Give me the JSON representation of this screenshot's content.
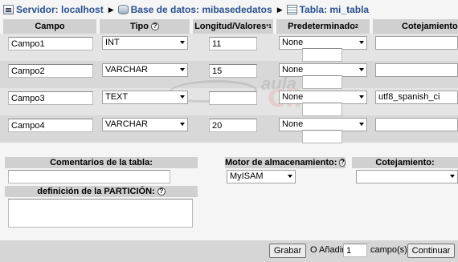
{
  "breadcrumb": {
    "server_label": "Servidor: localhost",
    "database_label": "Base de datos: mibasededatos",
    "table_label": "Tabla: mi_tabla"
  },
  "columns": {
    "campo": "Campo",
    "tipo": "Tipo",
    "longitud": "Longitud/Valores",
    "longitud_sup": "*1",
    "predeterminado": "Predeterminado",
    "predeterminado_sup": "2",
    "cotejamiento": "Cotejamiento"
  },
  "rows": [
    {
      "name": "Campo1",
      "type": "INT",
      "length": "11",
      "default": "None",
      "collation": ""
    },
    {
      "name": "Campo2",
      "type": "VARCHAR",
      "length": "15",
      "default": "None",
      "collation": ""
    },
    {
      "name": "Campo3",
      "type": "TEXT",
      "length": "",
      "default": "None",
      "collation": "utf8_spanish_ci"
    },
    {
      "name": "Campo4",
      "type": "VARCHAR",
      "length": "20",
      "default": "None",
      "collation": ""
    }
  ],
  "watermark": {
    "line1": "aula",
    "line2": "Clic",
    "line3": ".com"
  },
  "table_options": {
    "comments_label": "Comentarios de la tabla:",
    "comments_value": "",
    "engine_label": "Motor de almacenamiento:",
    "engine_value": "MyISAM",
    "collation_label": "Cotejamiento:",
    "collation_value": "",
    "partition_label": "definición de la PARTICIÓN:",
    "partition_value": ""
  },
  "footer": {
    "save_label": "Grabar",
    "or_add_label": "O Añadir",
    "add_count": "1",
    "fields_label": "campo(s)",
    "continue_label": "Continuar"
  },
  "icons": {
    "help": "help-icon",
    "server": "server-icon",
    "database": "database-icon",
    "table": "table-icon"
  }
}
